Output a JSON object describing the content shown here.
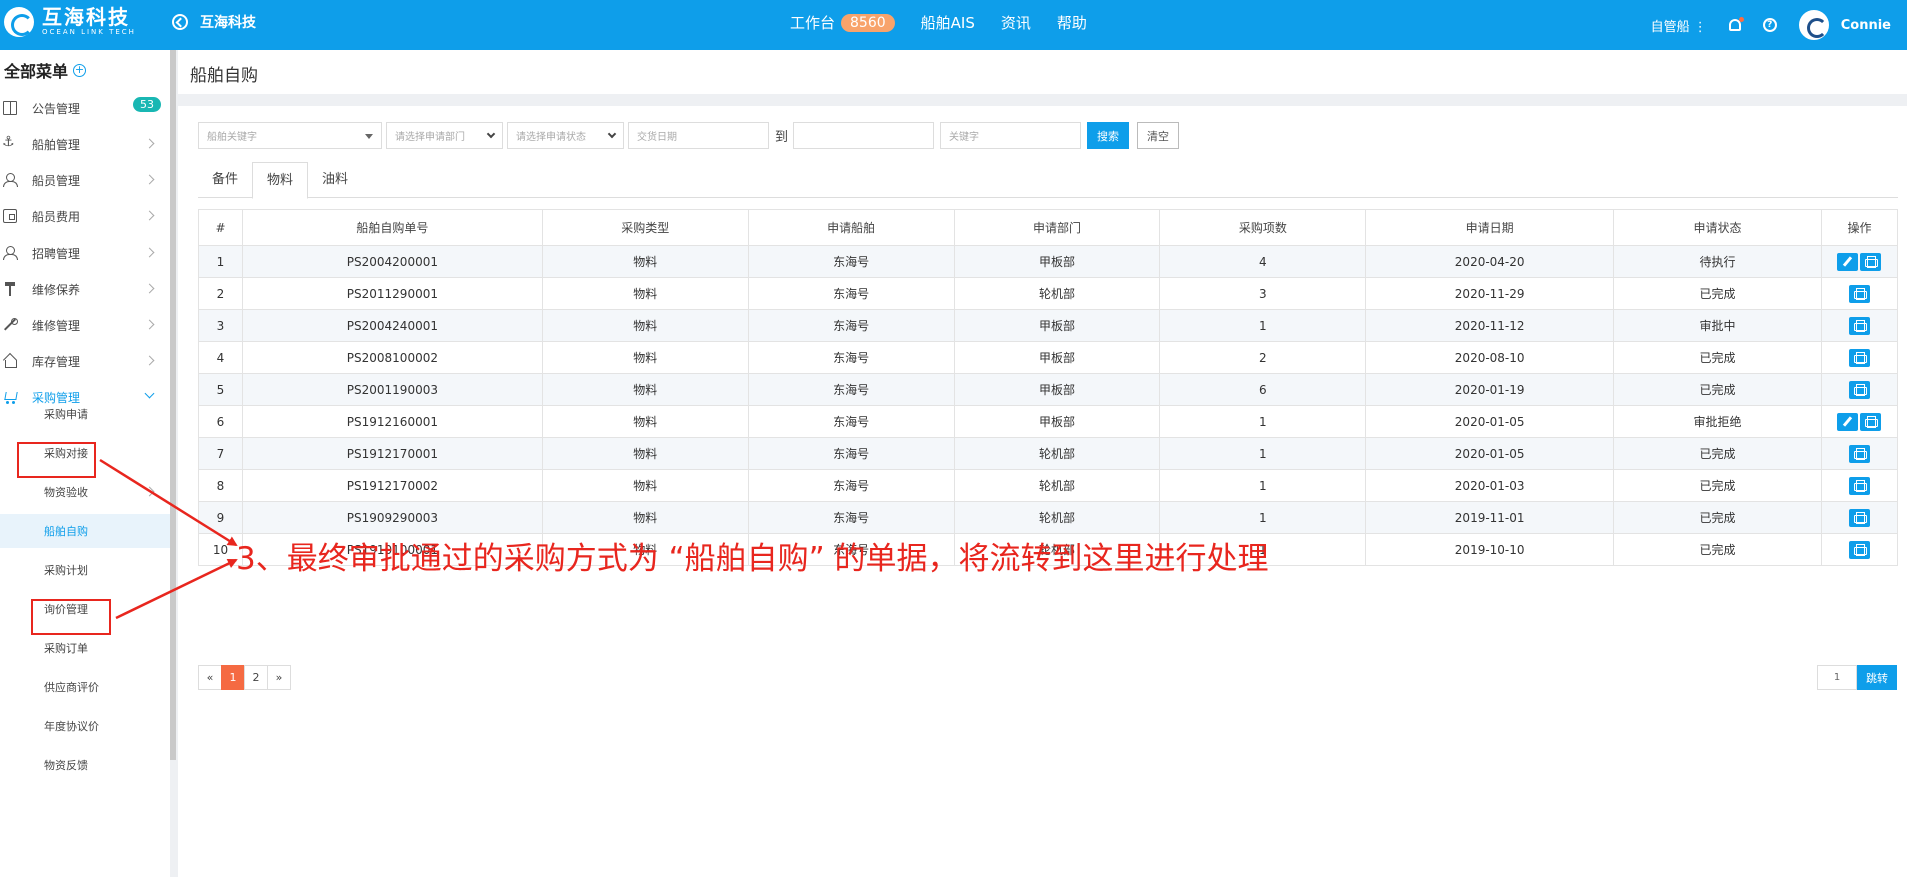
{
  "header": {
    "logo_cn": "互海科技",
    "logo_en": "OCEAN LINK TECH",
    "back_label": "互海科技",
    "nav": [
      {
        "label": "工作台",
        "badge": "8560"
      },
      {
        "label": "船舶AIS"
      },
      {
        "label": "资讯"
      },
      {
        "label": "帮助"
      }
    ],
    "ship_selector": "自管船 ⋮",
    "user_name": "Connie",
    "colors": {
      "topbar": "#0e9eea",
      "badge": "#f8a36b"
    }
  },
  "sidebar": {
    "title": "全部菜单",
    "items": [
      {
        "label": "公告管理",
        "icon": "book-icon",
        "badge": "53"
      },
      {
        "label": "船舶管理",
        "icon": "anchor-icon"
      },
      {
        "label": "船员管理",
        "icon": "person-icon"
      },
      {
        "label": "船员费用",
        "icon": "wallet-icon"
      },
      {
        "label": "招聘管理",
        "icon": "person-icon"
      },
      {
        "label": "维修保养",
        "icon": "tool-icon"
      },
      {
        "label": "维修管理",
        "icon": "wrench-icon"
      },
      {
        "label": "库存管理",
        "icon": "home-icon"
      },
      {
        "label": "采购管理",
        "icon": "cart-icon",
        "expanded": true
      }
    ],
    "subitems": [
      {
        "label": "采购申请"
      },
      {
        "label": "采购对接"
      },
      {
        "label": "物资验收"
      },
      {
        "label": "船舶自购",
        "active": true
      },
      {
        "label": "采购计划"
      },
      {
        "label": "询价管理"
      },
      {
        "label": "采购订单"
      },
      {
        "label": "供应商评价"
      },
      {
        "label": "年度协议价"
      },
      {
        "label": "物资反馈"
      }
    ]
  },
  "page": {
    "title": "船舶自购",
    "filters": {
      "ship_keyword": "船舶关键字",
      "dept": "请选择申请部门",
      "status": "请选择申请状态",
      "date_from": "交货日期",
      "to": "到",
      "keyword": "关键字",
      "search": "搜索",
      "clear": "清空"
    },
    "tabs": [
      "备件",
      "物料",
      "油料"
    ],
    "active_tab": 1,
    "table": {
      "columns": [
        "#",
        "船舶自购单号",
        "采购类型",
        "申请船舶",
        "申请部门",
        "采购项数",
        "申请日期",
        "申请状态",
        "操作"
      ],
      "rows": [
        {
          "no": "1",
          "order": "PS2004200001",
          "type": "物料",
          "ship": "东海号",
          "dept": "甲板部",
          "count": "4",
          "date": "2020-04-20",
          "status": "待执行",
          "ops": [
            "edit",
            "print"
          ]
        },
        {
          "no": "2",
          "order": "PS2011290001",
          "type": "物料",
          "ship": "东海号",
          "dept": "轮机部",
          "count": "3",
          "date": "2020-11-29",
          "status": "已完成",
          "ops": [
            "print"
          ]
        },
        {
          "no": "3",
          "order": "PS2004240001",
          "type": "物料",
          "ship": "东海号",
          "dept": "甲板部",
          "count": "1",
          "date": "2020-11-12",
          "status": "审批中",
          "ops": [
            "print"
          ]
        },
        {
          "no": "4",
          "order": "PS2008100002",
          "type": "物料",
          "ship": "东海号",
          "dept": "甲板部",
          "count": "2",
          "date": "2020-08-10",
          "status": "已完成",
          "ops": [
            "print"
          ]
        },
        {
          "no": "5",
          "order": "PS2001190003",
          "type": "物料",
          "ship": "东海号",
          "dept": "甲板部",
          "count": "6",
          "date": "2020-01-19",
          "status": "已完成",
          "ops": [
            "print"
          ]
        },
        {
          "no": "6",
          "order": "PS1912160001",
          "type": "物料",
          "ship": "东海号",
          "dept": "甲板部",
          "count": "1",
          "date": "2020-01-05",
          "status": "审批拒绝",
          "ops": [
            "edit",
            "print"
          ]
        },
        {
          "no": "7",
          "order": "PS1912170001",
          "type": "物料",
          "ship": "东海号",
          "dept": "轮机部",
          "count": "1",
          "date": "2020-01-05",
          "status": "已完成",
          "ops": [
            "print"
          ]
        },
        {
          "no": "8",
          "order": "PS1912170002",
          "type": "物料",
          "ship": "东海号",
          "dept": "轮机部",
          "count": "1",
          "date": "2020-01-03",
          "status": "已完成",
          "ops": [
            "print"
          ]
        },
        {
          "no": "9",
          "order": "PS1909290003",
          "type": "物料",
          "ship": "东海号",
          "dept": "轮机部",
          "count": "1",
          "date": "2019-11-01",
          "status": "已完成",
          "ops": [
            "print"
          ]
        },
        {
          "no": "10",
          "order": "PS1910100001",
          "type": "物料",
          "ship": "东海号",
          "dept": "轮机部",
          "count": "1",
          "date": "2019-10-10",
          "status": "已完成",
          "ops": [
            "print"
          ]
        }
      ]
    },
    "pager": {
      "prev": "«",
      "pages": [
        "1",
        "2"
      ],
      "current": "1",
      "next": "»",
      "jump_value": "1",
      "jump_label": "跳转"
    }
  },
  "annotation": {
    "text": "3、最终审批通过的采购方式为 “船舶自购” 的单据，将流转到这里进行处理",
    "color": "#e8261e"
  }
}
